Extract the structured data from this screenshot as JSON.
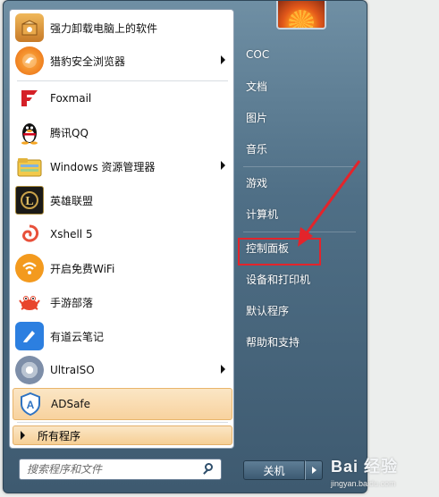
{
  "left_menu": {
    "items": [
      {
        "label": "强力卸载电脑上的软件",
        "icon": "uninstall-box-icon",
        "submenu": false
      },
      {
        "label": "猎豹安全浏览器",
        "icon": "cheetah-browser-icon",
        "submenu": true
      },
      {
        "label": "Foxmail",
        "icon": "foxmail-icon",
        "submenu": false
      },
      {
        "label": "腾讯QQ",
        "icon": "qq-penguin-icon",
        "submenu": false
      },
      {
        "label": "Windows 资源管理器",
        "icon": "explorer-folder-icon",
        "submenu": true
      },
      {
        "label": "英雄联盟",
        "icon": "lol-icon",
        "submenu": false
      },
      {
        "label": "Xshell 5",
        "icon": "xshell-icon",
        "submenu": false
      },
      {
        "label": "开启免费WiFi",
        "icon": "wifi-icon",
        "submenu": false
      },
      {
        "label": "手游部落",
        "icon": "crab-icon",
        "submenu": false
      },
      {
        "label": "有道云笔记",
        "icon": "youdao-note-icon",
        "submenu": false
      },
      {
        "label": "UltraISO",
        "icon": "ultraiso-disc-icon",
        "submenu": true
      },
      {
        "label": "ADSafe",
        "icon": "adsafe-shield-icon",
        "submenu": false
      }
    ],
    "all_programs": "所有程序",
    "search_placeholder": "搜索程序和文件"
  },
  "right_menu": {
    "items": [
      "COC",
      "文档",
      "图片",
      "音乐",
      "游戏",
      "计算机",
      "控制面板",
      "设备和打印机",
      "默认程序",
      "帮助和支持"
    ],
    "highlighted": "控制面板",
    "shutdown_label": "关机"
  },
  "watermark": {
    "brand": "Bai 经验",
    "sub": "jingyan.baidu.com"
  },
  "colors": {
    "highlight_box": "#e3242b",
    "menu_accent": "#4f6f86",
    "hover": "#f8d29e"
  }
}
